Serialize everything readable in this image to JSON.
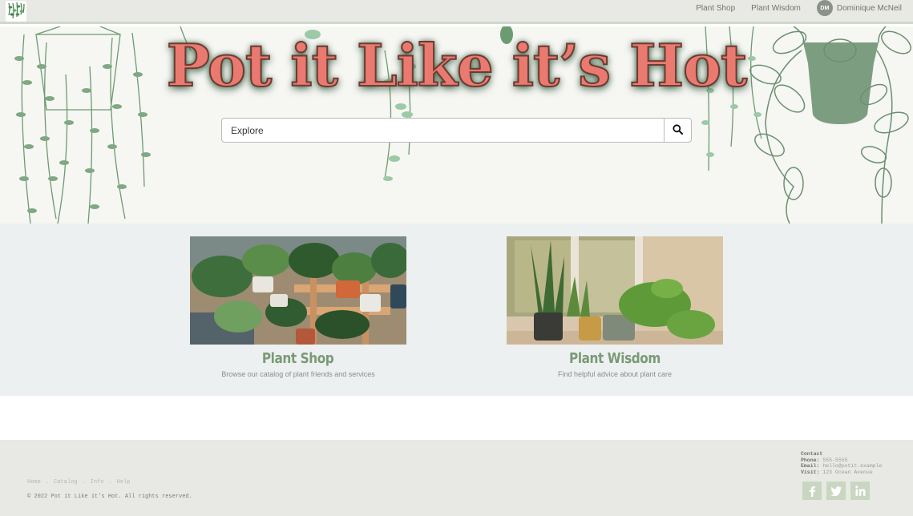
{
  "nav": {
    "logo_icon": "plant-logo-icon",
    "links": [
      "Plant Shop",
      "Plant Wisdom"
    ],
    "user": {
      "initials": "DM",
      "name": "Dominique McNeil"
    }
  },
  "hero": {
    "title": "Pot it Like it’s Hot",
    "search": {
      "placeholder": "Explore",
      "button_icon": "search-icon"
    }
  },
  "cards": [
    {
      "title": "Plant Shop",
      "description": "Browse our catalog of plant friends and services",
      "image": "potted-plants-photo"
    },
    {
      "title": "Plant Wisdom",
      "description": "Find helpful advice about plant care",
      "image": "window-plants-photo"
    }
  ],
  "footer": {
    "links": [
      "Home",
      "Catalog",
      "Info",
      "Help"
    ],
    "separator": ".",
    "copyright": "© 2022 Pot it Like it’s Hot. All rights reserved.",
    "contact": {
      "heading": "Contact",
      "phone_label": "Phone:",
      "phone": "555-5555",
      "email_label": "Email:",
      "email": "hello@potit.example",
      "visit_label": "Visit:",
      "visit": "123 Ocean Avenue"
    },
    "socials": [
      "facebook-icon",
      "twitter-icon",
      "linkedin-icon"
    ]
  },
  "colors": {
    "accent_green": "#7a9a76",
    "title_coral": "#ea7a70",
    "nav_bg": "#e8e9e4",
    "cards_bg": "#edf0f0"
  }
}
